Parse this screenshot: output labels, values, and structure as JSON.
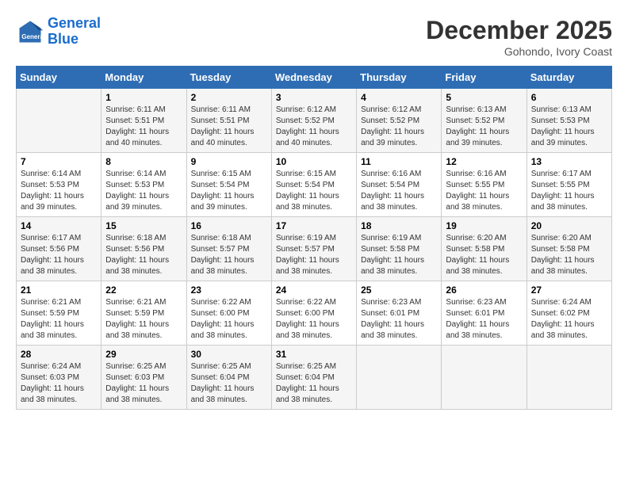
{
  "header": {
    "logo_line1": "General",
    "logo_line2": "Blue",
    "month": "December 2025",
    "location": "Gohondo, Ivory Coast"
  },
  "weekdays": [
    "Sunday",
    "Monday",
    "Tuesday",
    "Wednesday",
    "Thursday",
    "Friday",
    "Saturday"
  ],
  "weeks": [
    [
      {
        "day": "",
        "sunrise": "",
        "sunset": "",
        "daylight": ""
      },
      {
        "day": "1",
        "sunrise": "Sunrise: 6:11 AM",
        "sunset": "Sunset: 5:51 PM",
        "daylight": "Daylight: 11 hours and 40 minutes."
      },
      {
        "day": "2",
        "sunrise": "Sunrise: 6:11 AM",
        "sunset": "Sunset: 5:51 PM",
        "daylight": "Daylight: 11 hours and 40 minutes."
      },
      {
        "day": "3",
        "sunrise": "Sunrise: 6:12 AM",
        "sunset": "Sunset: 5:52 PM",
        "daylight": "Daylight: 11 hours and 40 minutes."
      },
      {
        "day": "4",
        "sunrise": "Sunrise: 6:12 AM",
        "sunset": "Sunset: 5:52 PM",
        "daylight": "Daylight: 11 hours and 39 minutes."
      },
      {
        "day": "5",
        "sunrise": "Sunrise: 6:13 AM",
        "sunset": "Sunset: 5:52 PM",
        "daylight": "Daylight: 11 hours and 39 minutes."
      },
      {
        "day": "6",
        "sunrise": "Sunrise: 6:13 AM",
        "sunset": "Sunset: 5:53 PM",
        "daylight": "Daylight: 11 hours and 39 minutes."
      }
    ],
    [
      {
        "day": "7",
        "sunrise": "Sunrise: 6:14 AM",
        "sunset": "Sunset: 5:53 PM",
        "daylight": "Daylight: 11 hours and 39 minutes."
      },
      {
        "day": "8",
        "sunrise": "Sunrise: 6:14 AM",
        "sunset": "Sunset: 5:53 PM",
        "daylight": "Daylight: 11 hours and 39 minutes."
      },
      {
        "day": "9",
        "sunrise": "Sunrise: 6:15 AM",
        "sunset": "Sunset: 5:54 PM",
        "daylight": "Daylight: 11 hours and 39 minutes."
      },
      {
        "day": "10",
        "sunrise": "Sunrise: 6:15 AM",
        "sunset": "Sunset: 5:54 PM",
        "daylight": "Daylight: 11 hours and 38 minutes."
      },
      {
        "day": "11",
        "sunrise": "Sunrise: 6:16 AM",
        "sunset": "Sunset: 5:54 PM",
        "daylight": "Daylight: 11 hours and 38 minutes."
      },
      {
        "day": "12",
        "sunrise": "Sunrise: 6:16 AM",
        "sunset": "Sunset: 5:55 PM",
        "daylight": "Daylight: 11 hours and 38 minutes."
      },
      {
        "day": "13",
        "sunrise": "Sunrise: 6:17 AM",
        "sunset": "Sunset: 5:55 PM",
        "daylight": "Daylight: 11 hours and 38 minutes."
      }
    ],
    [
      {
        "day": "14",
        "sunrise": "Sunrise: 6:17 AM",
        "sunset": "Sunset: 5:56 PM",
        "daylight": "Daylight: 11 hours and 38 minutes."
      },
      {
        "day": "15",
        "sunrise": "Sunrise: 6:18 AM",
        "sunset": "Sunset: 5:56 PM",
        "daylight": "Daylight: 11 hours and 38 minutes."
      },
      {
        "day": "16",
        "sunrise": "Sunrise: 6:18 AM",
        "sunset": "Sunset: 5:57 PM",
        "daylight": "Daylight: 11 hours and 38 minutes."
      },
      {
        "day": "17",
        "sunrise": "Sunrise: 6:19 AM",
        "sunset": "Sunset: 5:57 PM",
        "daylight": "Daylight: 11 hours and 38 minutes."
      },
      {
        "day": "18",
        "sunrise": "Sunrise: 6:19 AM",
        "sunset": "Sunset: 5:58 PM",
        "daylight": "Daylight: 11 hours and 38 minutes."
      },
      {
        "day": "19",
        "sunrise": "Sunrise: 6:20 AM",
        "sunset": "Sunset: 5:58 PM",
        "daylight": "Daylight: 11 hours and 38 minutes."
      },
      {
        "day": "20",
        "sunrise": "Sunrise: 6:20 AM",
        "sunset": "Sunset: 5:58 PM",
        "daylight": "Daylight: 11 hours and 38 minutes."
      }
    ],
    [
      {
        "day": "21",
        "sunrise": "Sunrise: 6:21 AM",
        "sunset": "Sunset: 5:59 PM",
        "daylight": "Daylight: 11 hours and 38 minutes."
      },
      {
        "day": "22",
        "sunrise": "Sunrise: 6:21 AM",
        "sunset": "Sunset: 5:59 PM",
        "daylight": "Daylight: 11 hours and 38 minutes."
      },
      {
        "day": "23",
        "sunrise": "Sunrise: 6:22 AM",
        "sunset": "Sunset: 6:00 PM",
        "daylight": "Daylight: 11 hours and 38 minutes."
      },
      {
        "day": "24",
        "sunrise": "Sunrise: 6:22 AM",
        "sunset": "Sunset: 6:00 PM",
        "daylight": "Daylight: 11 hours and 38 minutes."
      },
      {
        "day": "25",
        "sunrise": "Sunrise: 6:23 AM",
        "sunset": "Sunset: 6:01 PM",
        "daylight": "Daylight: 11 hours and 38 minutes."
      },
      {
        "day": "26",
        "sunrise": "Sunrise: 6:23 AM",
        "sunset": "Sunset: 6:01 PM",
        "daylight": "Daylight: 11 hours and 38 minutes."
      },
      {
        "day": "27",
        "sunrise": "Sunrise: 6:24 AM",
        "sunset": "Sunset: 6:02 PM",
        "daylight": "Daylight: 11 hours and 38 minutes."
      }
    ],
    [
      {
        "day": "28",
        "sunrise": "Sunrise: 6:24 AM",
        "sunset": "Sunset: 6:03 PM",
        "daylight": "Daylight: 11 hours and 38 minutes."
      },
      {
        "day": "29",
        "sunrise": "Sunrise: 6:25 AM",
        "sunset": "Sunset: 6:03 PM",
        "daylight": "Daylight: 11 hours and 38 minutes."
      },
      {
        "day": "30",
        "sunrise": "Sunrise: 6:25 AM",
        "sunset": "Sunset: 6:04 PM",
        "daylight": "Daylight: 11 hours and 38 minutes."
      },
      {
        "day": "31",
        "sunrise": "Sunrise: 6:25 AM",
        "sunset": "Sunset: 6:04 PM",
        "daylight": "Daylight: 11 hours and 38 minutes."
      },
      {
        "day": "",
        "sunrise": "",
        "sunset": "",
        "daylight": ""
      },
      {
        "day": "",
        "sunrise": "",
        "sunset": "",
        "daylight": ""
      },
      {
        "day": "",
        "sunrise": "",
        "sunset": "",
        "daylight": ""
      }
    ]
  ]
}
